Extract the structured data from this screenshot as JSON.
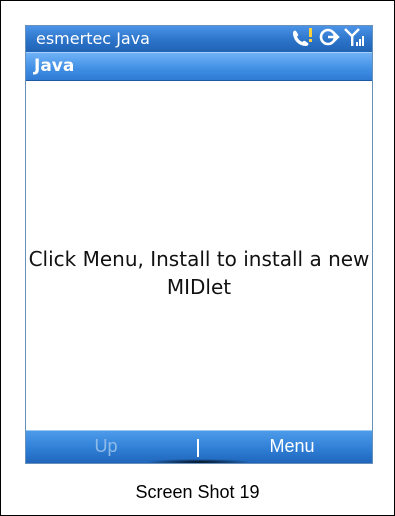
{
  "status_bar": {
    "title": "esmertec Java",
    "icons": [
      "missed-call-icon",
      "sync-icon",
      "signal-icon"
    ]
  },
  "title_bar": {
    "app_name": "Java"
  },
  "content": {
    "message": "Click Menu, Install to install a new MIDlet"
  },
  "softkeys": {
    "left": "Up",
    "right": "Menu"
  },
  "caption": "Screen Shot 19",
  "colors": {
    "bar_blue": "#2c74c9",
    "disabled_softkey": "#8fbbe8",
    "text": "#111111"
  }
}
